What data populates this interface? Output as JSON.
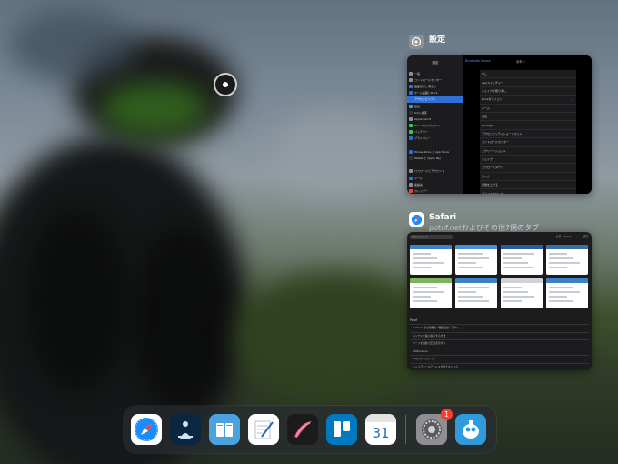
{
  "apps": {
    "settings": {
      "name": "設定",
      "sidebar_title": "設定",
      "header_back": "Bluetooth Mouse",
      "header_title": "ボタン",
      "sidebar_items": [
        {
          "label": "一般",
          "color": "#8e8e93"
        },
        {
          "label": "コントロールセンター",
          "color": "#8e8e93"
        },
        {
          "label": "画面表示と明るさ",
          "color": "#2f6fd6"
        },
        {
          "label": "ホーム画面とDock",
          "color": "#2f6fd6"
        },
        {
          "label": "アクセシビリティ",
          "color": "#2f6fd6",
          "selected": true
        },
        {
          "label": "壁紙",
          "color": "#30a2d8"
        },
        {
          "label": "Siriと検索",
          "color": "#333"
        },
        {
          "label": "Apple Pencil",
          "color": "#8e8e93"
        },
        {
          "label": "Face IDとパスコード",
          "color": "#34c759"
        },
        {
          "label": "バッテリー",
          "color": "#34c759"
        },
        {
          "label": "プライバシー",
          "color": "#2f6fd6"
        },
        {
          "label": "",
          "color": "transparent"
        },
        {
          "label": "iTunes Store と App Store",
          "color": "#2f6fd6"
        },
        {
          "label": "Wallet と Apple Pay",
          "color": "#333"
        },
        {
          "label": "",
          "color": "transparent"
        },
        {
          "label": "パスワードとアカウント",
          "color": "#8e8e93"
        },
        {
          "label": "メール",
          "color": "#2f6fd6"
        },
        {
          "label": "連絡先",
          "color": "#8e8e93"
        },
        {
          "label": "カレンダー",
          "color": "#ff3b30"
        }
      ],
      "main_items": [
        {
          "label": "なし",
          "checked": false
        },
        {
          "label": "Appスイッチャー",
          "checked": false
        },
        {
          "label": "シェイクで取り消し",
          "checked": false
        },
        {
          "label": "Dockをアイコン",
          "checked": true
        },
        {
          "label": "ホーム",
          "checked": false
        },
        {
          "label": "通知",
          "checked": false
        },
        {
          "label": "Spotlight",
          "checked": false
        },
        {
          "label": "アクセシビリティショートカット",
          "checked": false
        },
        {
          "label": "コントロールセンター",
          "checked": false
        },
        {
          "label": "スクリーンショット",
          "checked": false
        },
        {
          "label": "シェイク",
          "checked": false
        },
        {
          "label": "スクロールダウン",
          "checked": false
        },
        {
          "label": "ズーム",
          "checked": false
        },
        {
          "label": "音量を上げる",
          "checked": false
        },
        {
          "label": "デバイスをロック",
          "checked": false
        },
        {
          "label": "ホームボタン",
          "checked": false
        },
        {
          "label": "音量を下げる",
          "checked": false
        }
      ]
    },
    "safari": {
      "name": "Safari",
      "subtitle": "potof.netおよびその他7個のタブ",
      "search_placeholder": "検索または入力",
      "private_label": "プライベート",
      "tab_colors": [
        "#3b82c4",
        "#4a90d9",
        "#2a5d9f",
        "#3a6ea5",
        "#7db35d",
        "#3b82c4",
        "#cfd3d8",
        "#3b82c4"
      ],
      "list_heading": "Potof",
      "list_items": [
        "Android 版で新機能（機能追加）アプリ",
        "ボックスを縮小表示する方法",
        "ページを自動で広告表示する",
        "softbank.ne",
        "Gitからトッピング",
        "キャリアメールアドレスが使えなくなる",
        "他社製品の詳細など"
      ]
    }
  },
  "dock": {
    "items": [
      {
        "name": "safari",
        "color": "#ffffff"
      },
      {
        "name": "kindle",
        "color": "#0b2640"
      },
      {
        "name": "books",
        "color": "#4aa3df"
      },
      {
        "name": "notes",
        "color": "#ffffff"
      },
      {
        "name": "procreate",
        "color": "#1b1b1b"
      },
      {
        "name": "trello",
        "color": "#0079bf"
      },
      {
        "name": "calendar",
        "color": "#ffffff"
      },
      {
        "name": "settings",
        "color": "#8e8e93"
      },
      {
        "name": "tweetbot",
        "color": "#2f9bdc"
      }
    ],
    "calendar_day": "31",
    "settings_badge": "1"
  }
}
